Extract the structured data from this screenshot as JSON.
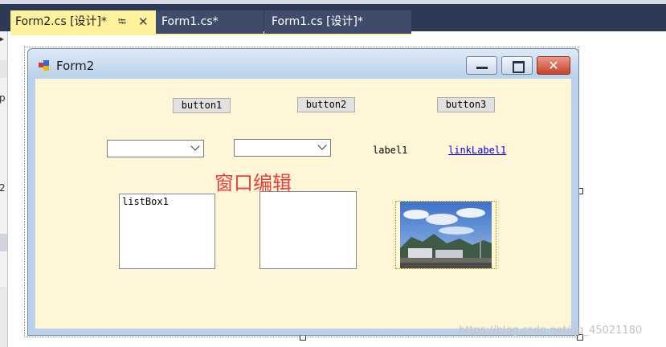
{
  "tabs": [
    {
      "label": "Form2.cs [设计]*",
      "active": true
    },
    {
      "label": "Form1.cs*",
      "active": false
    },
    {
      "label": "Form1.cs [设计]*",
      "active": false
    }
  ],
  "left_panel_fragments": [
    "▸",
    "p",
    "2"
  ],
  "form": {
    "title": "Form2"
  },
  "controls": {
    "button1": "button1",
    "button2": "button2",
    "button3": "button3",
    "label1": "label1",
    "link_label1": "linkLabel1",
    "heading": "窗口编辑",
    "listbox1_item": "listBox1"
  },
  "watermark": "https://blog.csdn.net/qq_45021180",
  "colors": {
    "tab_active": "#fff29d",
    "tab_bar": "#2d3a55",
    "form_client": "#fff6d8",
    "heading_red": "#e8403a",
    "link_blue": "#0000ee"
  },
  "icons": [
    "pin-icon",
    "close-icon",
    "form-app-icon",
    "minimize-icon",
    "maximize-icon",
    "window-close-icon",
    "dropdown-arrow-icon"
  ]
}
